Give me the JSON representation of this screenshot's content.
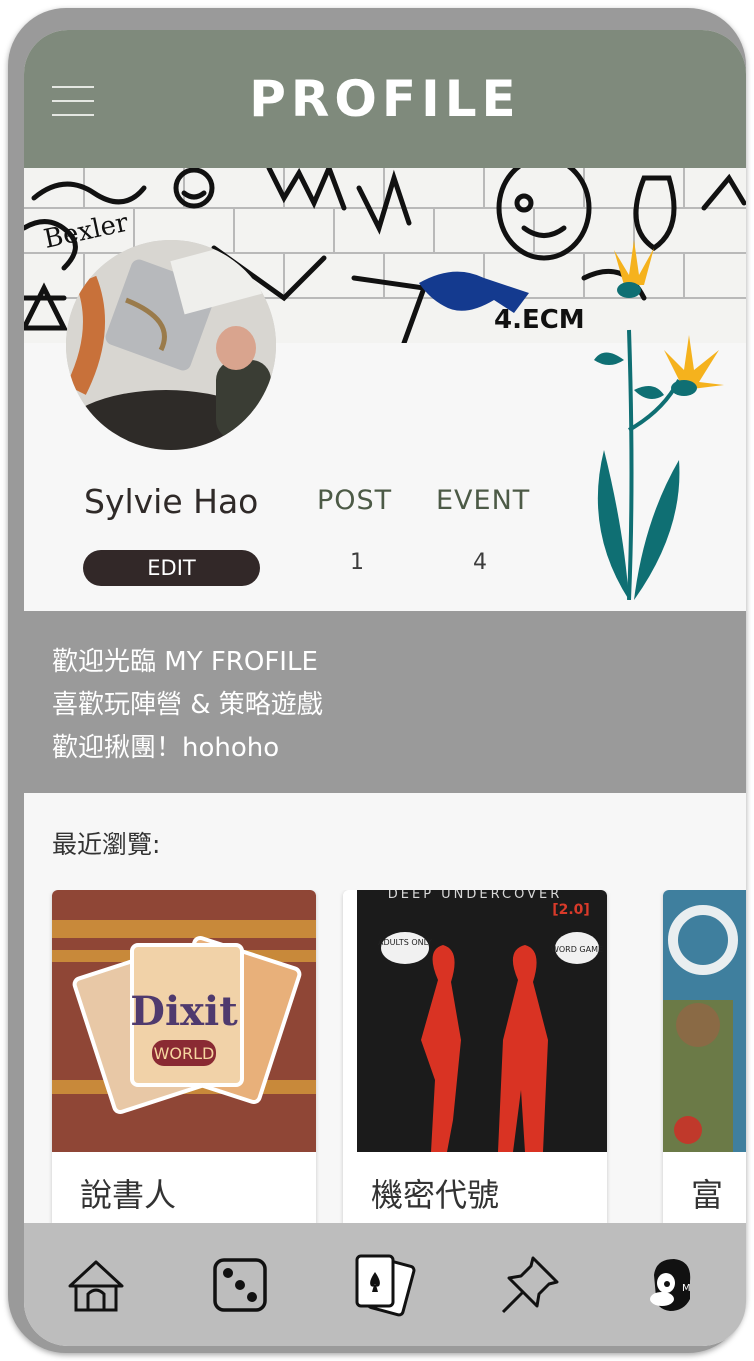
{
  "header": {
    "title": "PROFILE"
  },
  "profile": {
    "name": "Sylvie Hao",
    "edit_label": "EDIT",
    "stats": [
      {
        "label": "POST",
        "value": "1"
      },
      {
        "label": "EVENT",
        "value": "4"
      }
    ]
  },
  "bio": {
    "lines": [
      "歡迎光臨 MY FROFILE",
      "喜歡玩陣營 & 策略遊戲",
      "歡迎揪團！hohoho"
    ]
  },
  "recent": {
    "title": "最近瀏覽:",
    "items": [
      {
        "label": "說書人",
        "cover_text": "Dixit",
        "cover_subtext": "WORLD"
      },
      {
        "label": "機密代號",
        "cover_text": "DEEP UNDERCOVER",
        "cover_subtext": "[2.0]",
        "bubble_left": "ADULTS ONLY",
        "bubble_right": "WORD GAME"
      },
      {
        "label": "富"
      }
    ]
  },
  "nav": {
    "items": [
      {
        "icon": "hut-icon"
      },
      {
        "icon": "dice-icon"
      },
      {
        "icon": "playing-cards-icon"
      },
      {
        "icon": "pushpin-icon"
      },
      {
        "icon": "avatar-face-icon"
      }
    ]
  },
  "colors": {
    "header_bg": "#7f8a7c",
    "bio_bg": "#9a9a9a",
    "nav_bg": "#bdbdbd",
    "edit_bg": "#322828",
    "stat_label": "#4c5a46"
  }
}
